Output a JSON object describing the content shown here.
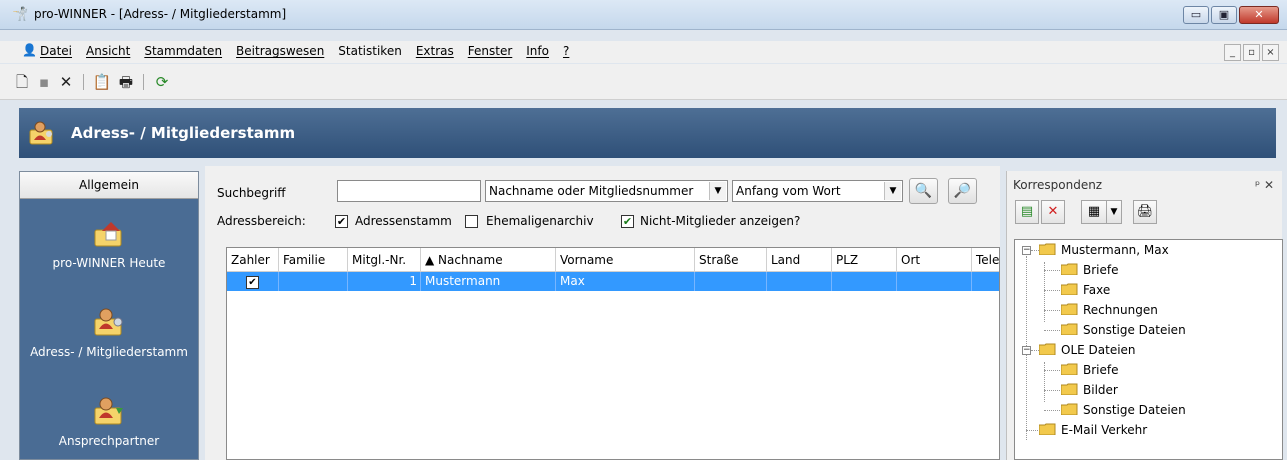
{
  "window": {
    "title": "pro-WINNER - [Adress- / Mitgliederstamm]",
    "min": "▭",
    "max": "▣",
    "close": "✕"
  },
  "menu": {
    "items": [
      "Datei",
      "Ansicht",
      "Stammdaten",
      "Beitragswesen",
      "Statistiken",
      "Extras",
      "Fenster",
      "Info",
      "?"
    ],
    "mdi": [
      "_",
      "▫",
      "×"
    ]
  },
  "toolbar": {
    "icons": [
      "new-document-icon",
      "save-icon",
      "delete-icon",
      "properties-icon",
      "print-icon",
      "refresh-icon"
    ]
  },
  "header": {
    "title": "Adress- / Mitgliederstamm"
  },
  "nav": {
    "head": "Allgemein",
    "items": [
      {
        "label": "pro-WINNER Heute",
        "icon": "home-icon"
      },
      {
        "label": "Adress- / Mitgliederstamm",
        "icon": "members-icon"
      },
      {
        "label": "Ansprechpartner",
        "icon": "contact-icon"
      }
    ]
  },
  "search": {
    "label": "Suchbegriff",
    "value": "",
    "field_combo": "Nachname oder Mitgliedsnummer",
    "mode_combo": "Anfang vom Wort",
    "range_label": "Adressbereich:",
    "opt_adressen": "Adressenstamm",
    "opt_adressen_checked": true,
    "opt_ehemalige": "Ehemaligenarchiv",
    "opt_ehemalige_checked": false,
    "opt_nicht": "Nicht-Mitglieder anzeigen?",
    "opt_nicht_checked": true
  },
  "grid": {
    "columns": [
      "Zahler",
      "Familie",
      "Mitgl.-Nr.",
      "▲ Nachname",
      "Vorname",
      "Straße",
      "Land",
      "PLZ",
      "Ort",
      "Tele"
    ],
    "rows": [
      {
        "zahler": "✔",
        "familie": "",
        "nr": "1",
        "nachname": "Mustermann",
        "vorname": "Max",
        "strasse": "",
        "land": "",
        "plz": "",
        "ort": "",
        "tele": ""
      }
    ]
  },
  "korrespondenz": {
    "title": "Korrespondenz",
    "controls": "ᵖ ✕",
    "tree": [
      {
        "label": "Mustermann, Max",
        "level": 0
      },
      {
        "label": "Briefe",
        "level": 1
      },
      {
        "label": "Faxe",
        "level": 1
      },
      {
        "label": "Rechnungen",
        "level": 1
      },
      {
        "label": "Sonstige Dateien",
        "level": 1
      },
      {
        "label": "OLE Dateien",
        "level": 0
      },
      {
        "label": "Briefe",
        "level": 1
      },
      {
        "label": "Bilder",
        "level": 1
      },
      {
        "label": "Sonstige Dateien",
        "level": 1
      },
      {
        "label": "E-Mail Verkehr",
        "level": 0
      }
    ]
  },
  "colors": {
    "accent": "#3399ff",
    "header": "#3f6189",
    "nav": "#4a6c94",
    "folder": "#f2c94c"
  }
}
